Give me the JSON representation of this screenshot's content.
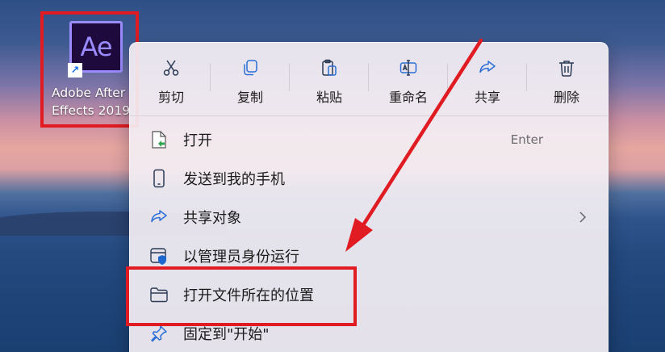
{
  "desktop": {
    "shortcut": {
      "logo_text": "Ae",
      "label_line1": "Adobe After",
      "label_line2": "Effects 2019"
    }
  },
  "menu": {
    "toolbar": [
      {
        "label": "剪切",
        "icon": "scissors-icon"
      },
      {
        "label": "复制",
        "icon": "copy-icon"
      },
      {
        "label": "粘贴",
        "icon": "paste-icon"
      },
      {
        "label": "重命名",
        "icon": "rename-icon"
      },
      {
        "label": "共享",
        "icon": "share-icon"
      },
      {
        "label": "删除",
        "icon": "trash-icon"
      }
    ],
    "items": [
      {
        "label": "打开",
        "shortcut": "Enter",
        "icon": "open-file-icon"
      },
      {
        "label": "发送到我的手机",
        "icon": "phone-icon"
      },
      {
        "label": "共享对象",
        "icon": "share-icon",
        "submenu": true
      },
      {
        "label": "以管理员身份运行",
        "icon": "admin-shield-icon"
      },
      {
        "label": "打开文件所在的位置",
        "icon": "folder-icon"
      },
      {
        "label": "固定到\"开始\"",
        "icon": "pin-icon"
      }
    ]
  },
  "colors": {
    "highlight": "#e01b22",
    "ae_border": "#9a8cff",
    "ae_bg": "#1f0a3d"
  }
}
